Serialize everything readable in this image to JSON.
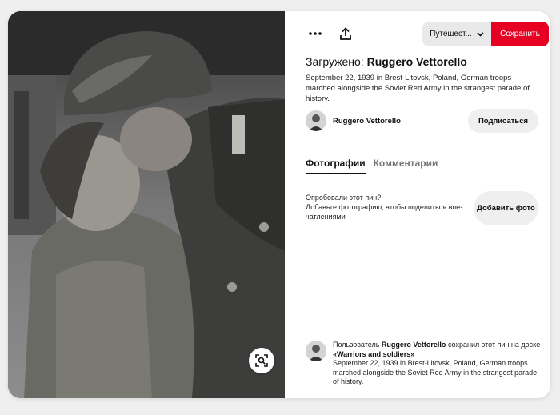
{
  "toolbar": {
    "more_icon": "more-horizontal-icon",
    "share_icon": "share-upload-icon",
    "board_select_label": "Путешест...",
    "save_label": "Сохранить",
    "accent_color": "#e60023"
  },
  "pin": {
    "title_prefix": "Загружено:",
    "title_user": "Ruggero Vettorello",
    "description": "September 22, 1939 in Brest-Litovsk, Poland, German troops marched alongside the Soviet Red Army in the strangest parade of history."
  },
  "author": {
    "name": "Ruggero Vettorello",
    "subscribe_label": "Подписаться"
  },
  "tabs": [
    {
      "label": "Фотографии",
      "active": true
    },
    {
      "label": "Комментарии",
      "active": false
    }
  ],
  "tried": {
    "line1": "Опробовали этот пин?",
    "line2": "Добавьте фотографию, чтобы поделиться впе-чатлениями",
    "button_label": "Добавить фото"
  },
  "saved_by": {
    "prefix": "Пользователь",
    "user": "Ruggero Vettorello",
    "middle": "сохранил этот пин на доске",
    "board": "«Warriors and soldiers»",
    "description": "September 22, 1939 in Brest-Litovsk, Poland, German troops marched alongside the Soviet Red Army in the strangest parade of history."
  },
  "photo": {
    "lens_icon": "visual-search-icon"
  }
}
